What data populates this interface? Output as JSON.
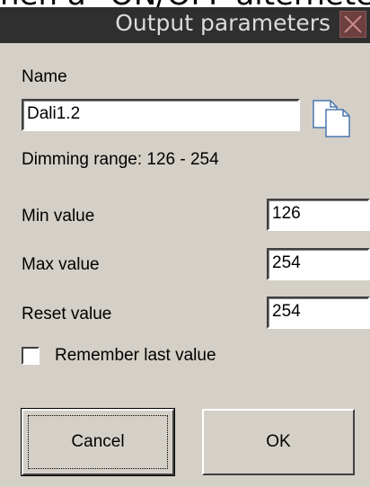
{
  "background_text": "hen a \"ON/OFF alterneted\" is",
  "window": {
    "title": "Output parameters"
  },
  "icons": {
    "close": "close-icon",
    "copy": "copy-icon"
  },
  "form": {
    "name_label": "Name",
    "name_value": "Dali1.2",
    "dimming_range_text": "Dimming range: 126 - 254",
    "min_label": "Min value",
    "min_value": "126",
    "max_label": "Max value",
    "max_value": "254",
    "reset_label": "Reset value",
    "reset_value": "254",
    "remember_label": "Remember last value",
    "remember_checked": false
  },
  "buttons": {
    "cancel": "Cancel",
    "ok": "OK"
  },
  "colors": {
    "dialog_bg": "#d4d0c8",
    "titlebar_bg": "#2f2f2f",
    "close_bg": "#6d3f3f"
  }
}
